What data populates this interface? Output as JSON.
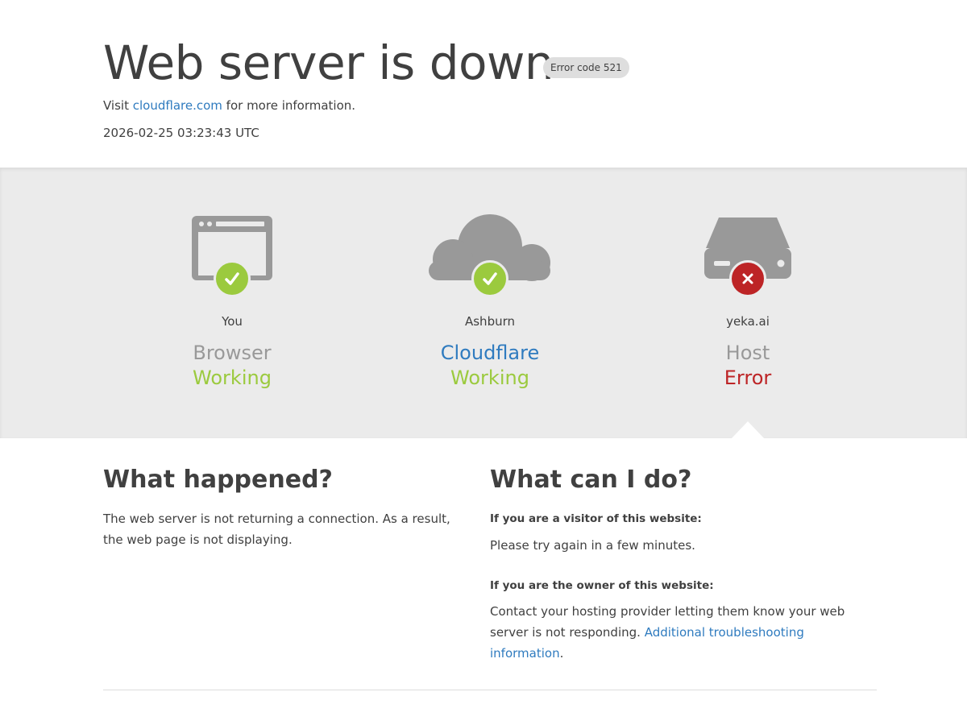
{
  "header": {
    "title": "Web server is down",
    "error_badge": "Error code 521",
    "visit_prefix": "Visit",
    "visit_link": "cloudflare.com",
    "visit_suffix": "for more information.",
    "timestamp": "2026-02-25 03:23:43 UTC"
  },
  "status": [
    {
      "location": "You",
      "kind": "Browser",
      "state": "Working",
      "icon": "browser-icon",
      "badge": "check"
    },
    {
      "location": "Ashburn",
      "kind": "Cloudflare",
      "state": "Working",
      "icon": "cloud-icon",
      "badge": "check"
    },
    {
      "location": "yeka.ai",
      "kind": "Host",
      "state": "Error",
      "icon": "server-icon",
      "badge": "cross"
    }
  ],
  "what_happened": {
    "heading": "What happened?",
    "body": "The web server is not returning a connection. As a result, the web page is not displaying."
  },
  "what_can_i_do": {
    "heading": "What can I do?",
    "visitor_label": "If you are a visitor of this website:",
    "visitor_text": "Please try again in a few minutes.",
    "owner_label": "If you are the owner of this website:",
    "owner_text": "Contact your hosting provider letting them know your web server is not responding.",
    "owner_link": "Additional troubleshooting information",
    "owner_period": "."
  },
  "colors": {
    "accent_link": "#2f7bbf",
    "working_green": "#9bca3e",
    "error_red": "#bd2426",
    "icon_gray": "#999999",
    "band_bg": "#ebebeb"
  }
}
